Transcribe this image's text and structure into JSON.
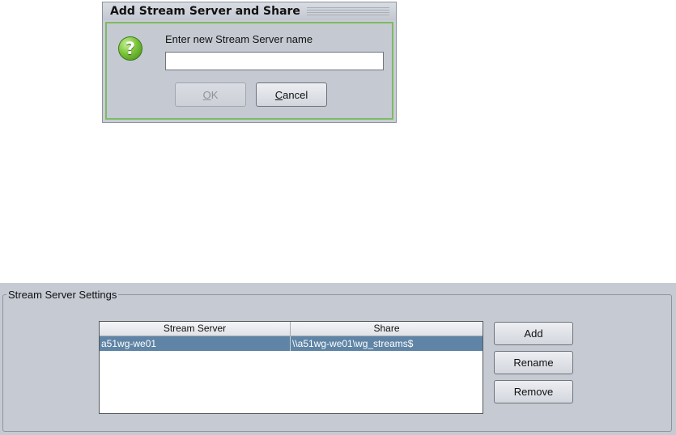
{
  "dialog": {
    "title": "Add Stream Server and Share",
    "icon": "question-icon",
    "icon_glyph": "?",
    "prompt": "Enter new Stream Server name",
    "input_value": "",
    "ok_label": "OK",
    "ok_mnemonic": "O",
    "ok_rest": "K",
    "ok_enabled": false,
    "cancel_label": "Cancel",
    "cancel_mnemonic": "C",
    "cancel_rest": "ancel",
    "colors": {
      "accent_border": "#7dbb63",
      "icon_green": "#7cc43a"
    }
  },
  "settings": {
    "legend": "Stream Server Settings",
    "table": {
      "columns": [
        "Stream Server",
        "Share"
      ],
      "rows": [
        {
          "server": "a51wg-we01",
          "share": "\\\\a51wg-we01\\wg_streams$",
          "selected": true
        }
      ],
      "selection_color": "#5f84a5"
    },
    "buttons": {
      "add": "Add",
      "rename": "Rename",
      "remove": "Remove"
    }
  }
}
